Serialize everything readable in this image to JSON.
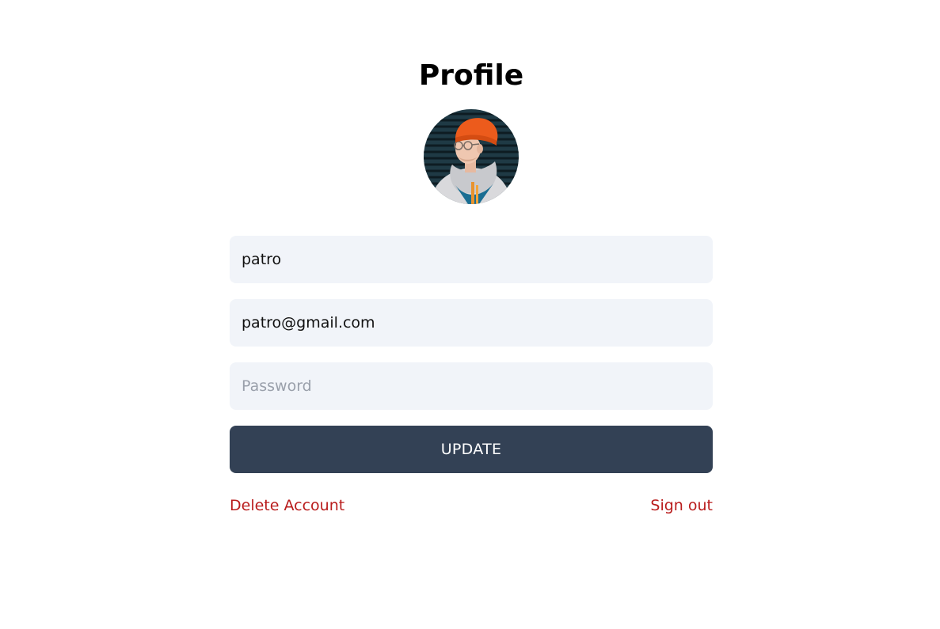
{
  "page": {
    "title": "Profile"
  },
  "avatar": {
    "alt": "profile photo"
  },
  "form": {
    "username_value": "patro",
    "email_value": "patro@gmail.com",
    "password_value": "",
    "password_placeholder": "Password",
    "update_label": "UPDATE"
  },
  "actions": {
    "delete_label": "Delete Account",
    "signout_label": "Sign out"
  },
  "colors": {
    "button_bg": "#334155",
    "input_bg": "#f1f4f9",
    "danger_text": "#b91c1c"
  }
}
